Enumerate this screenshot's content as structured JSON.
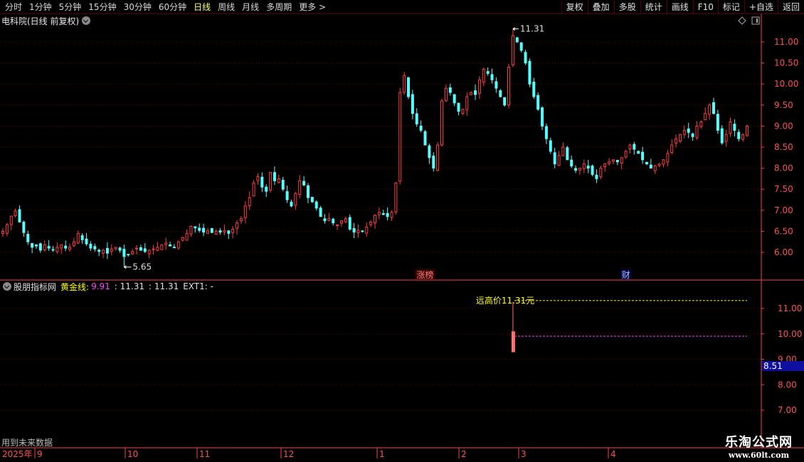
{
  "toolbar": {
    "periods": [
      {
        "label": "分时",
        "active": false
      },
      {
        "label": "1分钟",
        "active": false
      },
      {
        "label": "5分钟",
        "active": false
      },
      {
        "label": "15分钟",
        "active": false
      },
      {
        "label": "30分钟",
        "active": false
      },
      {
        "label": "60分钟",
        "active": false
      },
      {
        "label": "日线",
        "active": true
      },
      {
        "label": "周线",
        "active": false
      },
      {
        "label": "月线",
        "active": false
      },
      {
        "label": "多周期",
        "active": false
      },
      {
        "label": "更多 >",
        "active": false
      }
    ],
    "right_buttons": [
      "复权",
      "叠加",
      "多股",
      "统计",
      "画线",
      "F10",
      "标记",
      "+自选",
      "返回"
    ]
  },
  "chart_title": "电科院(日线 前复权)",
  "indicator": {
    "name": "股朋指标网",
    "gold_label": "黄金线:",
    "gold_value": "9.91",
    "v2": ": 11.31",
    "v3": ": 11.31",
    "ext": "EXT1: -",
    "annotation": "远高价11.31元"
  },
  "note": "用到未来数据",
  "watermark": {
    "cn": "乐淘公式网",
    "url": "www.60lt.com"
  },
  "colors": {
    "up": "#ff3c3c",
    "down": "#54ffff",
    "grid": "#6a0000",
    "axis": "#ff4040",
    "gold": "#ffff00",
    "magenta": "#ff44ff"
  },
  "chart_data": {
    "type": "candlestick",
    "price_ticks": [
      "11.00",
      "10.50",
      "10.00",
      "9.50",
      "9.00",
      "8.50",
      "8.00",
      "7.50",
      "7.00",
      "6.50",
      "6.00"
    ],
    "high_label": "11.31",
    "low_label": "5.65",
    "events": [
      {
        "label": "涨榜",
        "bar": 101
      },
      {
        "label": "财",
        "bar": 149
      }
    ],
    "x_labels": [
      "2025年",
      "9",
      "10",
      "11",
      "12",
      "1",
      "2",
      "3",
      "4"
    ],
    "indicator_ticks": [
      "11.00",
      "10.00",
      "9.00",
      "8.00",
      "7.00"
    ],
    "indicator_badge": "8.51",
    "indicator_lines": {
      "yellow": 11.31,
      "magenta": 9.91
    },
    "closes": [
      6.5,
      6.66,
      6.86,
      6.98,
      6.72,
      6.47,
      6.25,
      6.12,
      6.15,
      6.05,
      6.18,
      6.1,
      6.06,
      6.12,
      6.18,
      6.1,
      6.12,
      6.25,
      6.45,
      6.3,
      6.2,
      6.1,
      6.08,
      6.02,
      6.05,
      5.98,
      6.08,
      6.12,
      6.05,
      5.9,
      5.95,
      6.02,
      6.1,
      6.05,
      6.02,
      6.05,
      6.08,
      6.12,
      6.18,
      6.22,
      6.15,
      6.12,
      6.25,
      6.35,
      6.45,
      6.62,
      6.58,
      6.52,
      6.48,
      6.52,
      6.47,
      6.5,
      6.48,
      6.52,
      6.45,
      6.55,
      6.7,
      6.8,
      7.1,
      7.3,
      7.65,
      7.8,
      7.55,
      7.45,
      7.9,
      7.7,
      7.75,
      7.5,
      7.25,
      7.1,
      7.4,
      7.7,
      7.6,
      7.3,
      7.2,
      7.05,
      6.85,
      6.75,
      6.8,
      6.7,
      6.65,
      6.75,
      6.8,
      6.55,
      6.48,
      6.52,
      6.5,
      6.6,
      6.72,
      6.88,
      6.95,
      6.9,
      6.85,
      6.95,
      7.65,
      9.8,
      10.2,
      9.7,
      9.3,
      9.05,
      8.9,
      8.55,
      8.25,
      8.0,
      8.55,
      9.6,
      9.9,
      9.8,
      9.55,
      9.35,
      9.4,
      9.7,
      9.8,
      9.75,
      10.1,
      10.35,
      10.25,
      10.1,
      9.9,
      9.7,
      9.5,
      10.4,
      11.15,
      11.0,
      10.8,
      10.5,
      10.0,
      9.7,
      9.4,
      9.0,
      8.7,
      8.4,
      8.1,
      8.3,
      8.5,
      8.2,
      8.05,
      7.95,
      8.0,
      8.1,
      8.0,
      7.85,
      7.75,
      8.0,
      8.1,
      8.15,
      8.2,
      8.15,
      8.25,
      8.4,
      8.55,
      8.45,
      8.35,
      8.2,
      8.1,
      8.0,
      8.05,
      8.1,
      8.2,
      8.35,
      8.55,
      8.7,
      8.8,
      8.9,
      8.85,
      8.75,
      9.0,
      9.1,
      9.3,
      9.5,
      9.3,
      8.9,
      8.6,
      8.8,
      9.1,
      8.9,
      8.7,
      8.8,
      9.0
    ]
  }
}
